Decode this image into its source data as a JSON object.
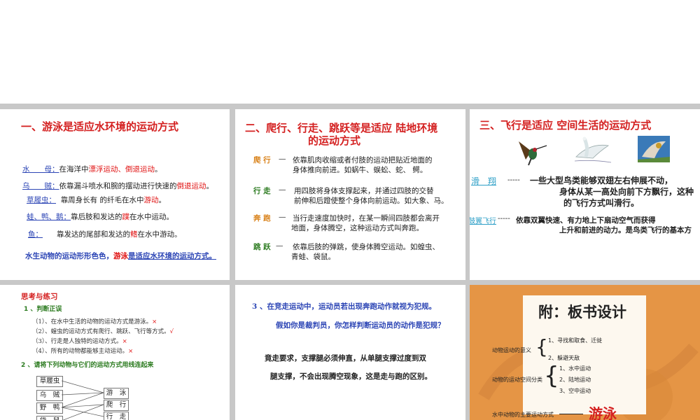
{
  "p1": {
    "title": "一、游泳是适应水环境的运动方式",
    "rows": [
      {
        "label": "水　　母：",
        "pre": "在海洋中",
        "red": "漂浮运动、倒退运动",
        "post": "。"
      },
      {
        "label": "乌　　贼：",
        "pre": "依靠漏斗喷水和腕的摆动进行快速的",
        "red": "倒退运动",
        "post": "。"
      },
      {
        "label": "草履虫：",
        "pre": "靠周身长有 的纤毛在水中",
        "red": "游动",
        "post": "。"
      },
      {
        "label": "蛙、鸭、鹅：",
        "pre": "靠后肢和发达的",
        "red": "蹼",
        "post": "在水中运动。"
      },
      {
        "label": "鱼：",
        "pre": "靠发达的尾部和发达的",
        "red": "鳍",
        "post": "在水中游动。"
      }
    ],
    "summary_pre": "水生动物的运动形形色色，",
    "summary_red": "游泳",
    "summary_post": "是适应水环境的运动方式。"
  },
  "p2": {
    "title_line1": "二、爬行、行走、跳跃等是适应  陆地环境",
    "title_line2": "的运动方式",
    "items": [
      {
        "label": "爬  行",
        "dash": "—",
        "line1": "依靠肌肉收缩或者付肢的运动把贴近地面的",
        "line2": "身体推向前进。如蜗牛、蜈蚣、蛇、  鳄。"
      },
      {
        "label": "行  走",
        "dash": "—",
        "line1": "用四肢将身体支撑起来，并通过四肢的交替",
        "line2": "前伸和后蹬使整个身体向前运动。如大象、马。"
      },
      {
        "label": "奔  跑",
        "dash": "—",
        "line1": "当行走速度加快时，在某一瞬间四肢都会离开",
        "line2": "地面，身体腾空，这种运动方式叫奔跑。"
      },
      {
        "label": "跳  跃",
        "dash": "—",
        "line1": "依靠后肢的弹跳，使身体腾空运动。如蝗虫、",
        "line2": "青蛙、袋鼠。"
      }
    ]
  },
  "p3": {
    "title": "三、飞行是适应  空间生活的运动方式",
    "glide_label": "滑　翔",
    "glide_dash": "-----",
    "glide_line1": "一些大型鸟类能够双翅左右伸展不动，",
    "glide_line2": "身体从某一高处向前下方飘行，这种",
    "glide_line3": "的飞行方式叫滑行。",
    "flap_label": "鼓翼飞行",
    "flap_dash": "-----",
    "flap_line1": "依靠双翼快速、有力地上下扇动空气而获得",
    "flap_line2": "上升和前进的动力。是鸟类飞行的基本方"
  },
  "p4": {
    "title": "思考与练习",
    "q1": "1 、判断正误",
    "judges": [
      {
        "text": "（1）、在水中生活的动物的运动方式是游泳。",
        "mark": "×"
      },
      {
        "text": "（2）、蝗虫的运动方式有爬行、跳跃、飞行等方式。",
        "mark": "√"
      },
      {
        "text": "（3）、行走是人独特的运动方式。",
        "mark": "×"
      },
      {
        "text": "（4）、所有的动物都能够主动运动。",
        "mark": "×"
      }
    ],
    "q2": "2 、请将下列动物与它们的运动方式用线连起来",
    "animals": [
      "草履虫",
      "乌　贼",
      "野　鸭",
      "袋　鼠"
    ],
    "modes": [
      "游　泳",
      "爬　行",
      "行　走"
    ]
  },
  "p5": {
    "q3": "3 、在竞走运动中，运动员若出现奔跑动作就视为犯规。",
    "q3b": "假如你是裁判员，你怎样判断运动员的动作是犯规？",
    "ans1": "竟走要求，支撑腿必须伸直，从单腿支撑过度到双",
    "ans2": "腿支撑，不会出现腾空现象，这是走与跑的区别。"
  },
  "p6": {
    "title": "附：板书设计",
    "meaning_label": "动物运动的意义",
    "meaning_items": [
      "1、寻找和取食、迁徙",
      "2、躲避天敌"
    ],
    "space_label": "动物的运动空间分类",
    "space_items": [
      "1、水中运动",
      "2、陆地运动",
      "3、空中运动"
    ],
    "main_label": "水中动物的主要运动方式",
    "main_value": "游泳"
  }
}
